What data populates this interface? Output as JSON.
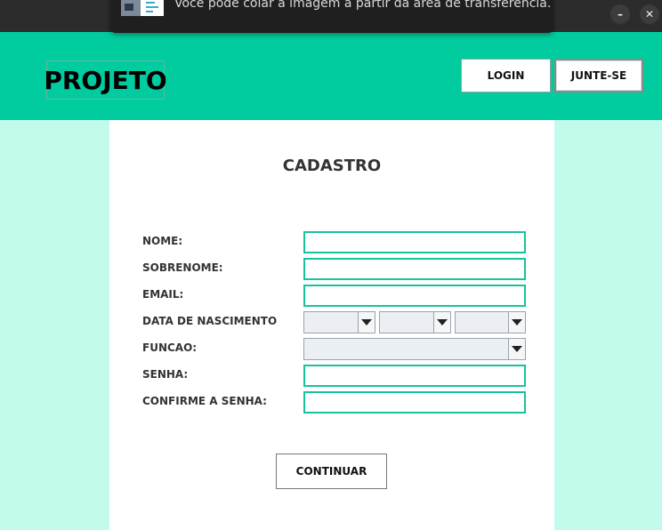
{
  "notification": {
    "text": "Você pode colar a imagem a partir da área de transferência."
  },
  "window": {
    "minimize_glyph": "–",
    "close_glyph": "✕"
  },
  "header": {
    "brand": "PROJETO",
    "login_label": "LOGIN",
    "join_label": "JUNTE-SE"
  },
  "form": {
    "title": "CADASTRO",
    "nome_label": "NOME:",
    "sobrenome_label": "SOBRENOME:",
    "email_label": "EMAIL:",
    "nascimento_label": "DATA DE NASCIMENTO",
    "funcao_label": "FUNCAO:",
    "senha_label": "SENHA:",
    "confirme_label": "CONFIRME A SENHA:",
    "nome_value": "",
    "sobrenome_value": "",
    "email_value": "",
    "senha_value": "",
    "confirme_value": "",
    "dia_value": "",
    "mes_value": "",
    "ano_value": "",
    "funcao_value": "",
    "continue_label": "CONTINUAR"
  },
  "colors": {
    "header_bg": "#00cc9f",
    "page_bg": "#c2fbec",
    "input_border": "#17c39c"
  }
}
